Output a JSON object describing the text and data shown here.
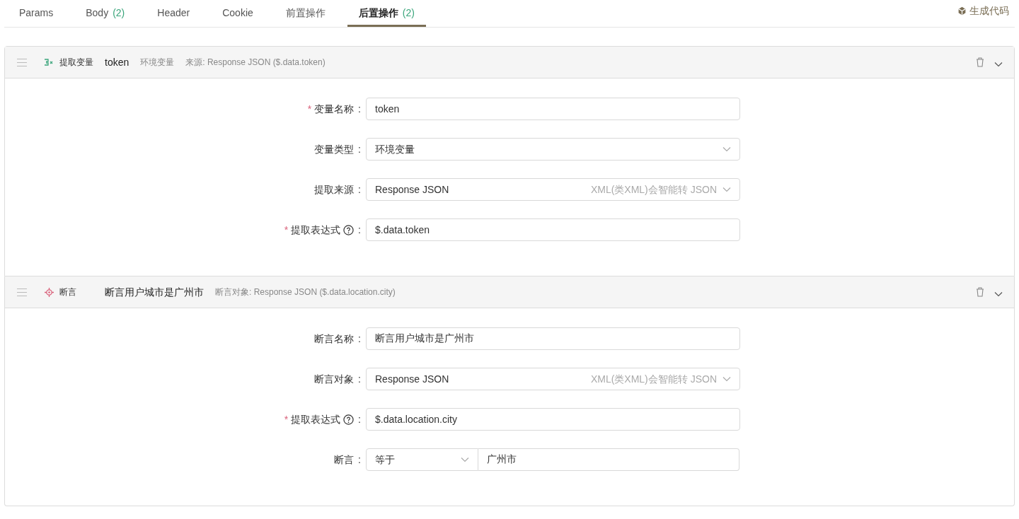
{
  "tabs": [
    {
      "label": "Params",
      "selected": false
    },
    {
      "label": "Body",
      "count": "(2)",
      "selected": false
    },
    {
      "label": "Header",
      "selected": false
    },
    {
      "label": "Cookie",
      "selected": false
    },
    {
      "label": "前置操作",
      "selected": false
    },
    {
      "label": "后置操作",
      "count": "(2)",
      "selected": true
    }
  ],
  "generate_code": "生成代码",
  "steps": [
    {
      "kind": "extract",
      "type_label": "提取变量",
      "title": "token",
      "subtitle": "环境变量",
      "summary": "来源: Response JSON ($.data.token)",
      "expanded": true,
      "fields": [
        {
          "kind": "input",
          "label": "变量名称",
          "required_mark": "*",
          "help": false,
          "separator": ":",
          "value": "token"
        },
        {
          "kind": "select",
          "label": "变量类型",
          "help": false,
          "separator": ":",
          "value": "环境变量"
        },
        {
          "kind": "select",
          "label": "提取来源",
          "help": false,
          "separator": ":",
          "value": "Response JSON",
          "hint": "XML(类XML)会智能转 JSON"
        },
        {
          "kind": "input",
          "label": "提取表达式",
          "required_mark": "*",
          "help": true,
          "separator": ":",
          "value": "$.data.token"
        }
      ]
    },
    {
      "kind": "assert",
      "type_label": "断言",
      "title": "断言用户城市是广州市",
      "summary": "断言对象: Response JSON ($.data.location.city)",
      "expanded": true,
      "fields": [
        {
          "kind": "input",
          "label": "断言名称",
          "help": false,
          "separator": ":",
          "value": "断言用户城市是广州市"
        },
        {
          "kind": "select",
          "label": "断言对象",
          "help": false,
          "separator": ":",
          "value": "Response JSON",
          "hint": "XML(类XML)会智能转 JSON"
        },
        {
          "kind": "input",
          "label": "提取表达式",
          "required_mark": "*",
          "help": true,
          "separator": ":",
          "value": "$.data.location.city"
        },
        {
          "kind": "compare",
          "label": "断言",
          "help": false,
          "separator": ":",
          "operator": "等于",
          "value": "广州市"
        }
      ]
    }
  ]
}
